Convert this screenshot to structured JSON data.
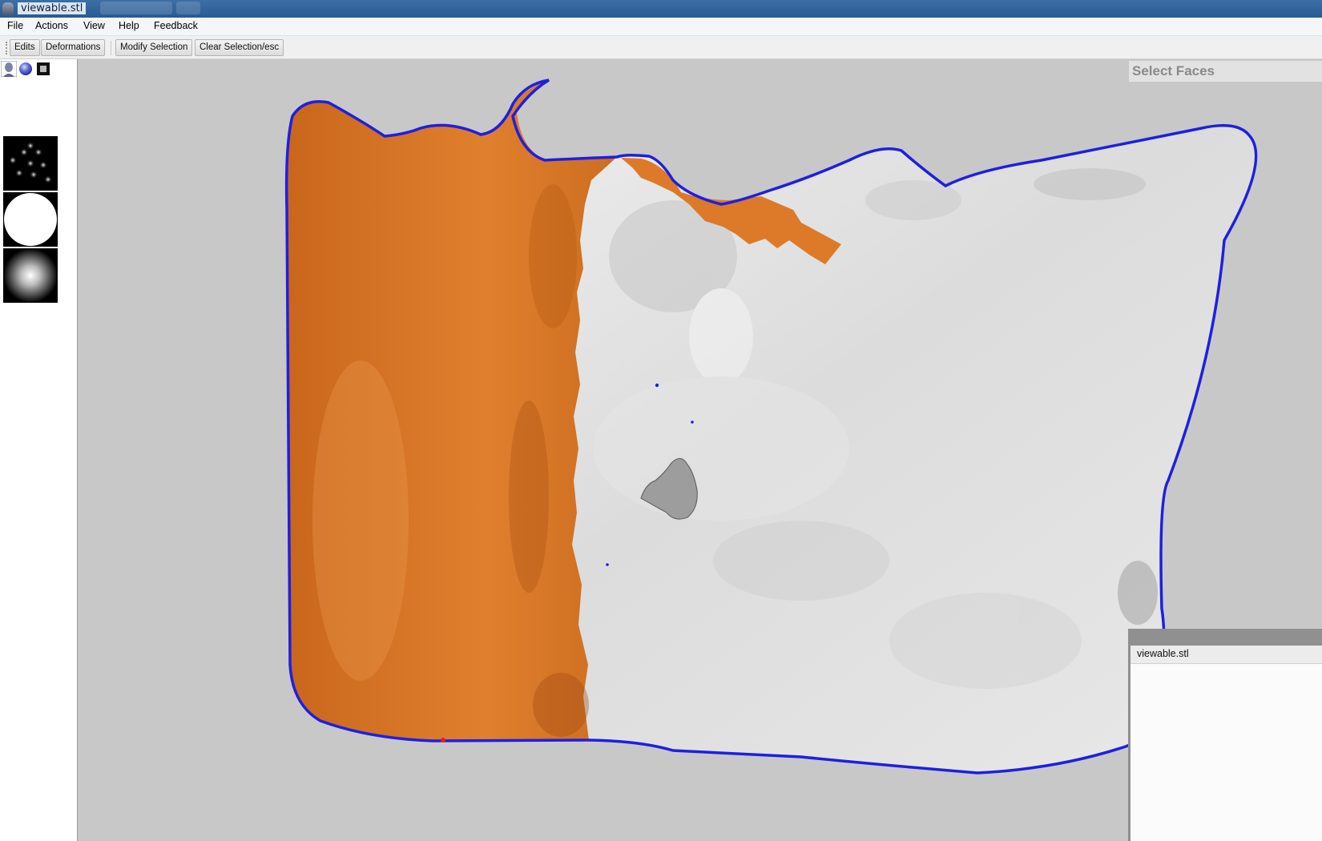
{
  "window": {
    "title": "viewable.stl"
  },
  "menubar": {
    "items": [
      "File",
      "Actions",
      "View",
      "Help",
      "Feedback"
    ]
  },
  "toolbar": {
    "buttons": [
      "Edits",
      "Deformations",
      "Modify Selection",
      "Clear Selection/esc"
    ]
  },
  "left_panel": {
    "mode_tabs": [
      "bust-icon",
      "sphere-icon",
      "square-icon"
    ],
    "brushes": [
      "scatter-dots-brush-icon",
      "hard-circle-brush-icon",
      "soft-circle-brush-icon"
    ]
  },
  "viewport": {
    "mode_label": "Select Faces",
    "colors": {
      "selection": "#d9782a",
      "mesh": "#e2e2e2",
      "boundary": "#1f1fe0",
      "background": "#c8c8c8"
    }
  },
  "side_window": {
    "title": "viewable.stl"
  }
}
